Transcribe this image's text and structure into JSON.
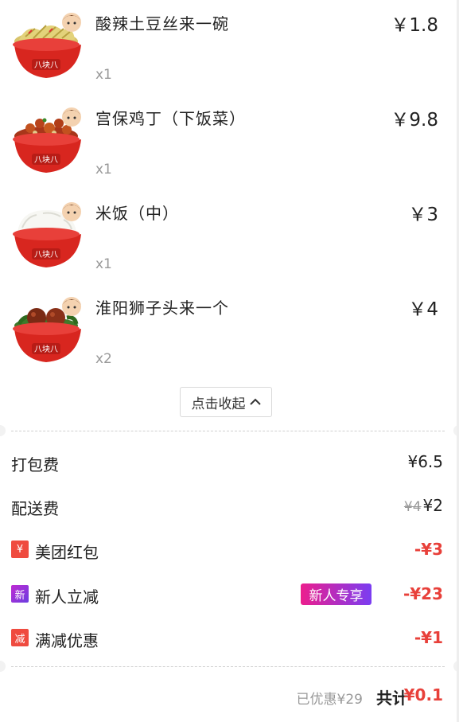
{
  "order": {
    "items": [
      {
        "name": "酸辣土豆丝来一碗",
        "price": "￥1.8",
        "qty": "x1",
        "image": "potato-shreds-bowl"
      },
      {
        "name": "宫保鸡丁（下饭菜）",
        "price": "￥9.8",
        "qty": "x1",
        "image": "kung-pao-chicken-bowl"
      },
      {
        "name": "米饭（中）",
        "price": "￥3",
        "qty": "x1",
        "image": "rice-bowl"
      },
      {
        "name": "淮阳狮子头来一个",
        "price": "￥4",
        "qty": "x2",
        "image": "lions-head-meatball-bowl"
      }
    ],
    "bowl_brand_text": "八块八",
    "collapse_label": "点击收起"
  },
  "fees": {
    "packaging": {
      "label": "打包费",
      "value": "¥6.5"
    },
    "delivery": {
      "label": "配送费",
      "original": "¥4",
      "value": "¥2"
    }
  },
  "discounts": [
    {
      "icon": "¥",
      "label": "美团红包",
      "value": "-¥3",
      "tag_color": "#ef4b3f"
    },
    {
      "icon": "新",
      "label": "新人立减",
      "badge": "新人专享",
      "value": "-¥23",
      "tag_color": "#9b35d9"
    },
    {
      "icon": "减",
      "label": "满减优惠",
      "value": "-¥1",
      "tag_color": "#ef4b3f"
    }
  ],
  "summary": {
    "saved": "已优惠¥29",
    "total_label": "共计",
    "total_value": "¥0.1"
  },
  "colors": {
    "accent_red": "#e8403a",
    "muted": "#999999"
  }
}
